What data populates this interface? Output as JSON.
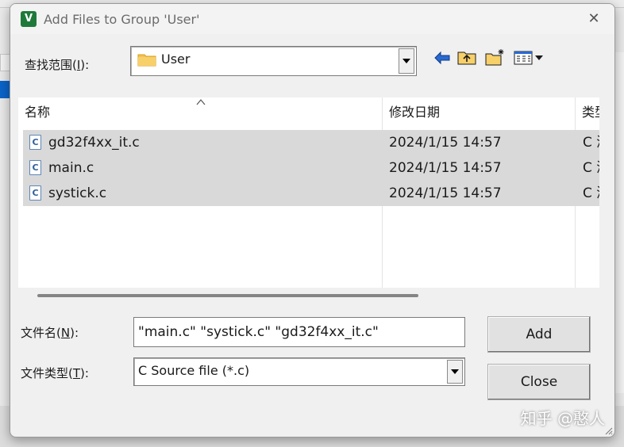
{
  "dialog": {
    "title": "Add Files to Group 'User'",
    "app_icon_letter": "V",
    "close_glyph": "✕"
  },
  "look_in": {
    "label_pre": "查找范围(",
    "label_key": "I",
    "label_post": "):",
    "value": "User"
  },
  "toolbar": {
    "icons": [
      "back-arrow-icon",
      "up-folder-icon",
      "new-folder-icon",
      "view-menu-icon"
    ]
  },
  "file_list": {
    "columns": [
      "名称",
      "修改日期",
      "类型"
    ],
    "rows": [
      {
        "name": "gd32f4xx_it.c",
        "date": "2024/1/15 14:57",
        "type": "C 源文件"
      },
      {
        "name": "main.c",
        "date": "2024/1/15 14:57",
        "type": "C 源文件"
      },
      {
        "name": "systick.c",
        "date": "2024/1/15 14:57",
        "type": "C 源文件"
      }
    ],
    "file_icon_letter": "C"
  },
  "file_name": {
    "label_pre": "文件名(",
    "label_key": "N",
    "label_post": "):",
    "value": "\"main.c\" \"systick.c\" \"gd32f4xx_it.c\""
  },
  "file_type": {
    "label_pre": "文件类型(",
    "label_key": "T",
    "label_post": "):",
    "value": "C Source file (*.c)"
  },
  "buttons": {
    "add": "Add",
    "close": "Close"
  },
  "watermark": "知乎 @憨人",
  "colors": {
    "selection": "#d9d9d9",
    "window_bg": "#f0f0f0",
    "folder": "#f3c24f"
  }
}
